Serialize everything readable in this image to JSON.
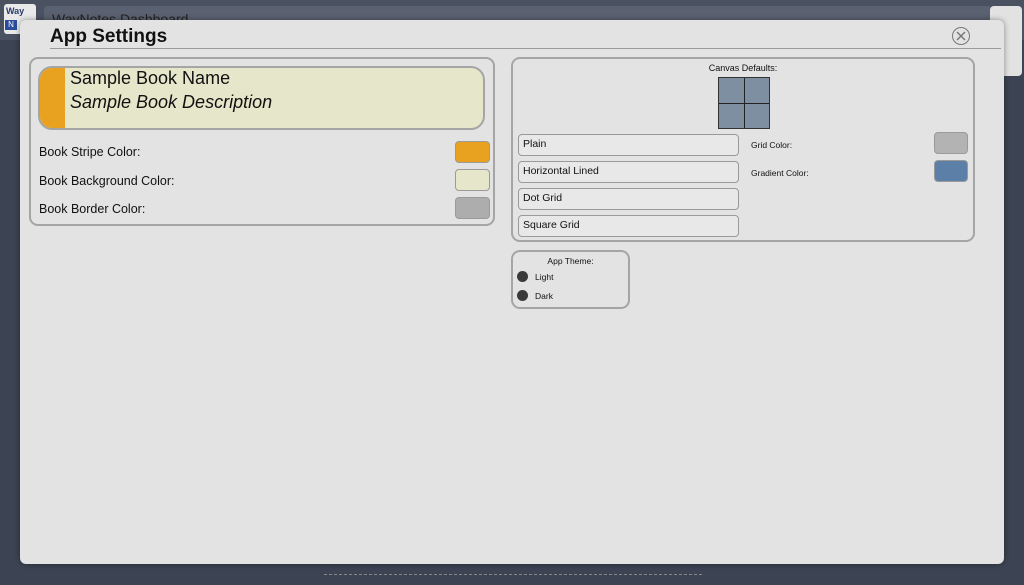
{
  "background": {
    "logo_text": "Way",
    "logo_badge": "N",
    "title": "WayNotes Dashboard"
  },
  "modal": {
    "title": "App Settings"
  },
  "book": {
    "name": "Sample Book Name",
    "description": "Sample Book Description",
    "stripe_color_label": "Book Stripe Color:",
    "background_color_label": "Book Background Color:",
    "border_color_label": "Book Border Color:",
    "colors": {
      "stripe": "#e9a120",
      "background": "#e6e6cb",
      "border": "#adadad"
    }
  },
  "canvas": {
    "title": "Canvas Defaults:",
    "options": [
      "Plain",
      "Horizontal Lined",
      "Dot Grid",
      "Square Grid"
    ],
    "grid_color_label": "Grid Color:",
    "gradient_color_label": "Gradient Color:",
    "colors": {
      "grid": "#b3b3b3",
      "gradient": "#5b7fa6",
      "preview": "#7d8fa0"
    }
  },
  "theme": {
    "title": "App Theme:",
    "options": [
      "Light",
      "Dark"
    ]
  },
  "icons": {
    "close": "close-circle-icon"
  }
}
